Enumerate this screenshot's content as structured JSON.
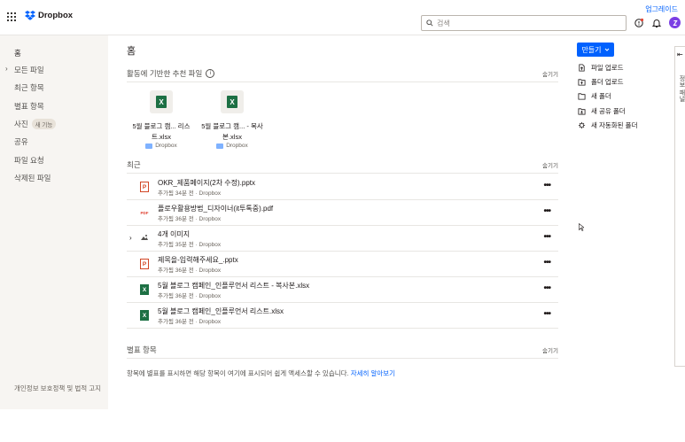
{
  "header": {
    "logo_text": "Dropbox",
    "upgrade_label": "업그레이드",
    "search_placeholder": "검색"
  },
  "sidebar": {
    "items": [
      {
        "label": "홈"
      },
      {
        "label": "모든 파일"
      },
      {
        "label": "최근 항목"
      },
      {
        "label": "별표 항목"
      },
      {
        "label": "사진",
        "badge": "새 기능"
      },
      {
        "label": "공유"
      },
      {
        "label": "파일 요청"
      },
      {
        "label": "삭제된 파일"
      }
    ],
    "footer": "개인정보 보호정책 및 법적 고지"
  },
  "main": {
    "title": "홈",
    "suggested": {
      "title": "활동에 기반한 추천 파일",
      "hide_label": "숨기기",
      "files": [
        {
          "name_line1": "5월 블로그 캠... 리스",
          "name_line2": "트.xlsx",
          "location": "Dropbox",
          "icon": "excel-icon"
        },
        {
          "name_line1": "5월 블로그 캠... - 복사",
          "name_line2": "본.xlsx",
          "location": "Dropbox",
          "icon": "excel-icon"
        }
      ]
    },
    "recent": {
      "title": "최근",
      "hide_label": "숨기기",
      "files": [
        {
          "name": "OKR_제품페이지(2차 수정).pptx",
          "meta": "추가됨 34분 전 · Dropbox",
          "icon": "powerpoint-icon"
        },
        {
          "name": "플로우활용방법_디자이너(it투톡중).pdf",
          "meta": "추가됨 36분 전 · Dropbox",
          "icon": "pdf-icon"
        },
        {
          "name": "4개 이미지",
          "meta": "추가됨 35분 전 · Dropbox",
          "icon": "image-icon"
        },
        {
          "name": "제목을-입력해주세요_.pptx",
          "meta": "추가됨 36분 전 · Dropbox",
          "icon": "powerpoint-icon"
        },
        {
          "name": "5월 블로그 캠페인_인플루언서 리스트 - 복사본.xlsx",
          "meta": "추가됨 36분 전 · Dropbox",
          "icon": "excel-icon"
        },
        {
          "name": "5월 블로그 캠페인_인플루언서 리스트.xlsx",
          "meta": "추가됨 36분 전 · Dropbox",
          "icon": "excel-icon"
        }
      ]
    },
    "starred": {
      "title": "별표 항목",
      "hide_label": "숨기기",
      "hint": "항목에 별표를 표시하면 해당 항목이 여기에 표시되어 쉽게 액세스할 수 있습니다. ",
      "hint_link": "자세히 알아보기"
    }
  },
  "actions": {
    "create_label": "만들기",
    "items": [
      {
        "label": "파일 업로드",
        "icon": "file-upload-icon"
      },
      {
        "label": "폴더 업로드",
        "icon": "folder-upload-icon"
      },
      {
        "label": "새 폴더",
        "icon": "new-folder-icon"
      },
      {
        "label": "새 공유 폴더",
        "icon": "shared-folder-icon"
      },
      {
        "label": "새 자동화된 폴더",
        "icon": "automated-folder-icon"
      }
    ]
  },
  "rail": {
    "label": "정보 패널"
  },
  "colors": {
    "accent": "#0061fe",
    "sidebar_bg": "#f7f5f2",
    "excel": "#1d7044",
    "powerpoint": "#d24726",
    "pdf": "#e04434",
    "avatar": "#7b3fe4"
  }
}
